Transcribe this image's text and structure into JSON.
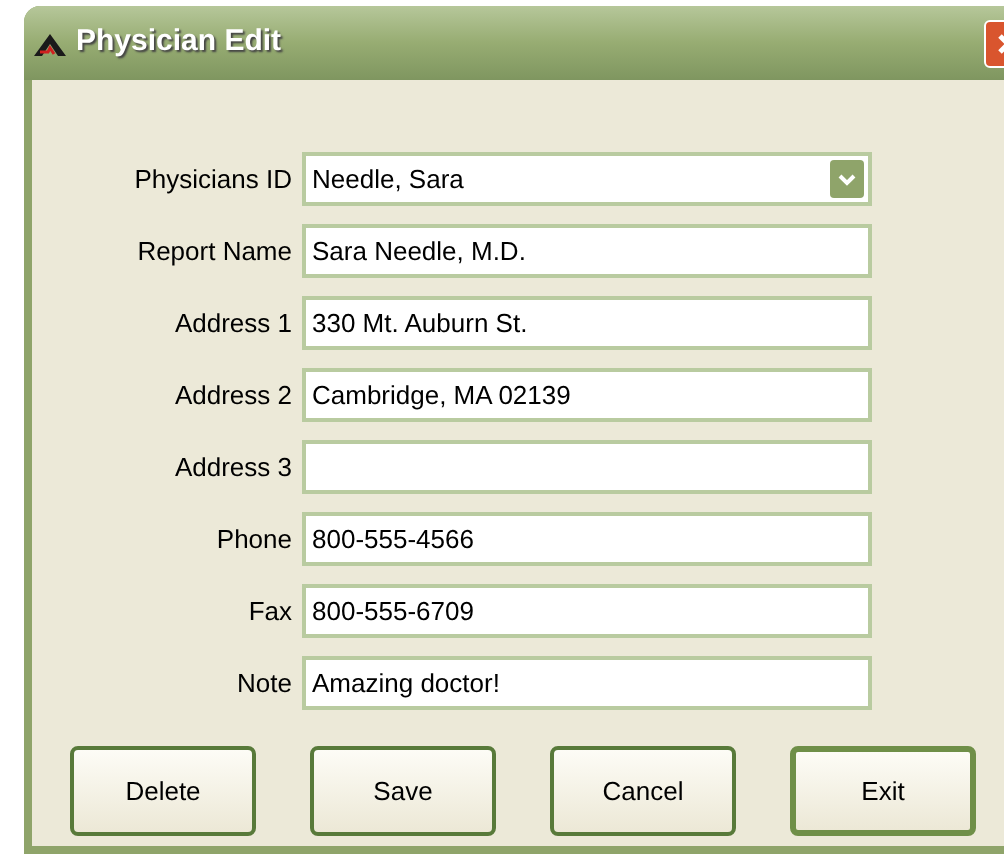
{
  "window": {
    "title": "Physician Edit"
  },
  "fields": [
    {
      "label": "Physicians ID",
      "value": "Needle, Sara",
      "kind": "dropdown"
    },
    {
      "label": "Report Name",
      "value": "Sara Needle, M.D.",
      "kind": "text"
    },
    {
      "label": "Address 1",
      "value": "330 Mt. Auburn St.",
      "kind": "text"
    },
    {
      "label": "Address 2",
      "value": "Cambridge, MA 02139",
      "kind": "text"
    },
    {
      "label": "Address 3",
      "kind": "text"
    },
    {
      "label": "Phone",
      "value": "800-555-4566",
      "kind": "text"
    },
    {
      "label": "Fax",
      "value": "800-555-6709",
      "kind": "text"
    },
    {
      "label": "Note",
      "value": "Amazing doctor!",
      "kind": "text"
    }
  ],
  "buttons": [
    {
      "label": "Delete",
      "default": false
    },
    {
      "label": "Save",
      "default": false
    },
    {
      "label": "Cancel",
      "default": false
    },
    {
      "label": "Exit",
      "default": true
    }
  ]
}
